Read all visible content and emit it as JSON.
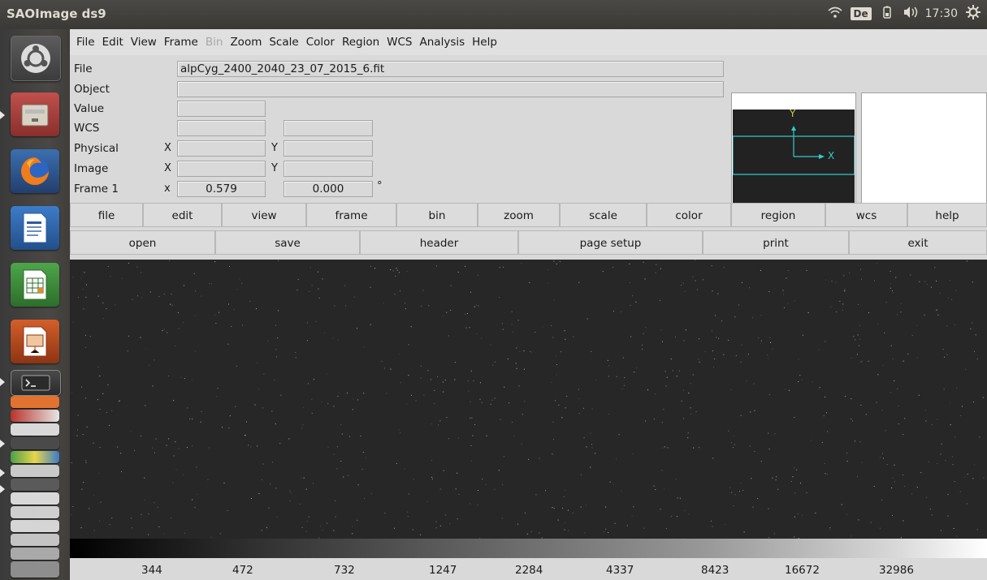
{
  "topbar": {
    "title": "SAOImage ds9",
    "keyboard_layout": "De",
    "clock": "17:30",
    "icons": [
      "wifi-icon",
      "keyboard-layout-indicator",
      "battery-icon",
      "volume-icon",
      "settings-gear-icon"
    ]
  },
  "launcher": {
    "items": [
      {
        "name": "ubuntu-dash-icon"
      },
      {
        "name": "files-icon"
      },
      {
        "name": "firefox-icon"
      },
      {
        "name": "libreoffice-writer-icon"
      },
      {
        "name": "libreoffice-calc-icon"
      },
      {
        "name": "libreoffice-impress-icon"
      },
      {
        "name": "terminal-icon"
      }
    ]
  },
  "menubar": {
    "items": [
      "File",
      "Edit",
      "View",
      "Frame",
      "Bin",
      "Zoom",
      "Scale",
      "Color",
      "Region",
      "WCS",
      "Analysis",
      "Help"
    ],
    "disabled": [
      "Bin"
    ]
  },
  "info": {
    "labels": {
      "file": "File",
      "object": "Object",
      "value": "Value",
      "wcs": "WCS",
      "physical": "Physical",
      "image": "Image",
      "frame": "Frame 1"
    },
    "file_value": "alpCyg_2400_2040_23_07_2015_6.fit",
    "object_value": "",
    "value_value": "",
    "axis_x": "X",
    "axis_y": "Y",
    "frame_axis": "x",
    "frame_zoom": "0.579",
    "frame_angle": "0.000",
    "degree_symbol": "°"
  },
  "panner": {
    "x_label": "X",
    "y_label": "Y",
    "colors": {
      "compass": "#33cccc",
      "y_axis": "#cccc33"
    }
  },
  "buttonbar": {
    "main": [
      "file",
      "edit",
      "view",
      "frame",
      "bin",
      "zoom",
      "scale",
      "color",
      "region",
      "wcs",
      "help"
    ],
    "sub": [
      "open",
      "save",
      "header",
      "page setup",
      "print",
      "exit"
    ]
  },
  "colorbar": {
    "ticks": [
      "344",
      "472",
      "732",
      "1247",
      "2284",
      "4337",
      "8423",
      "16672",
      "32986"
    ]
  }
}
